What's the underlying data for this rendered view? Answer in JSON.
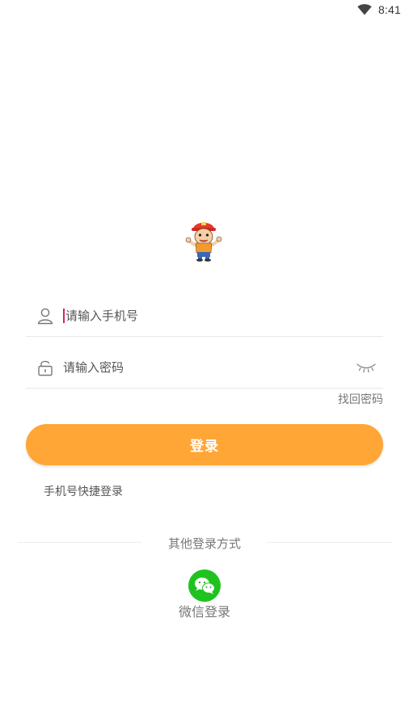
{
  "status_bar": {
    "time": "8:41",
    "wifi_icon": "wifi-icon"
  },
  "mascot": {
    "icon": "mascot-logo"
  },
  "form": {
    "phone": {
      "icon": "user-icon",
      "placeholder": "请输入手机号",
      "value": ""
    },
    "password": {
      "icon": "lock-icon",
      "placeholder": "请输入密码",
      "value": "",
      "toggle_icon": "eye-closed-icon"
    },
    "forgot_label": "找回密码",
    "login_label": "登录",
    "quick_login_label": "手机号快捷登录"
  },
  "other_login": {
    "title": "其他登录方式",
    "wechat_label": "微信登录",
    "wechat_icon": "wechat-icon"
  },
  "colors": {
    "accent": "#ffa636",
    "wechat_green": "#1fc31f",
    "caret": "#d6245a"
  }
}
